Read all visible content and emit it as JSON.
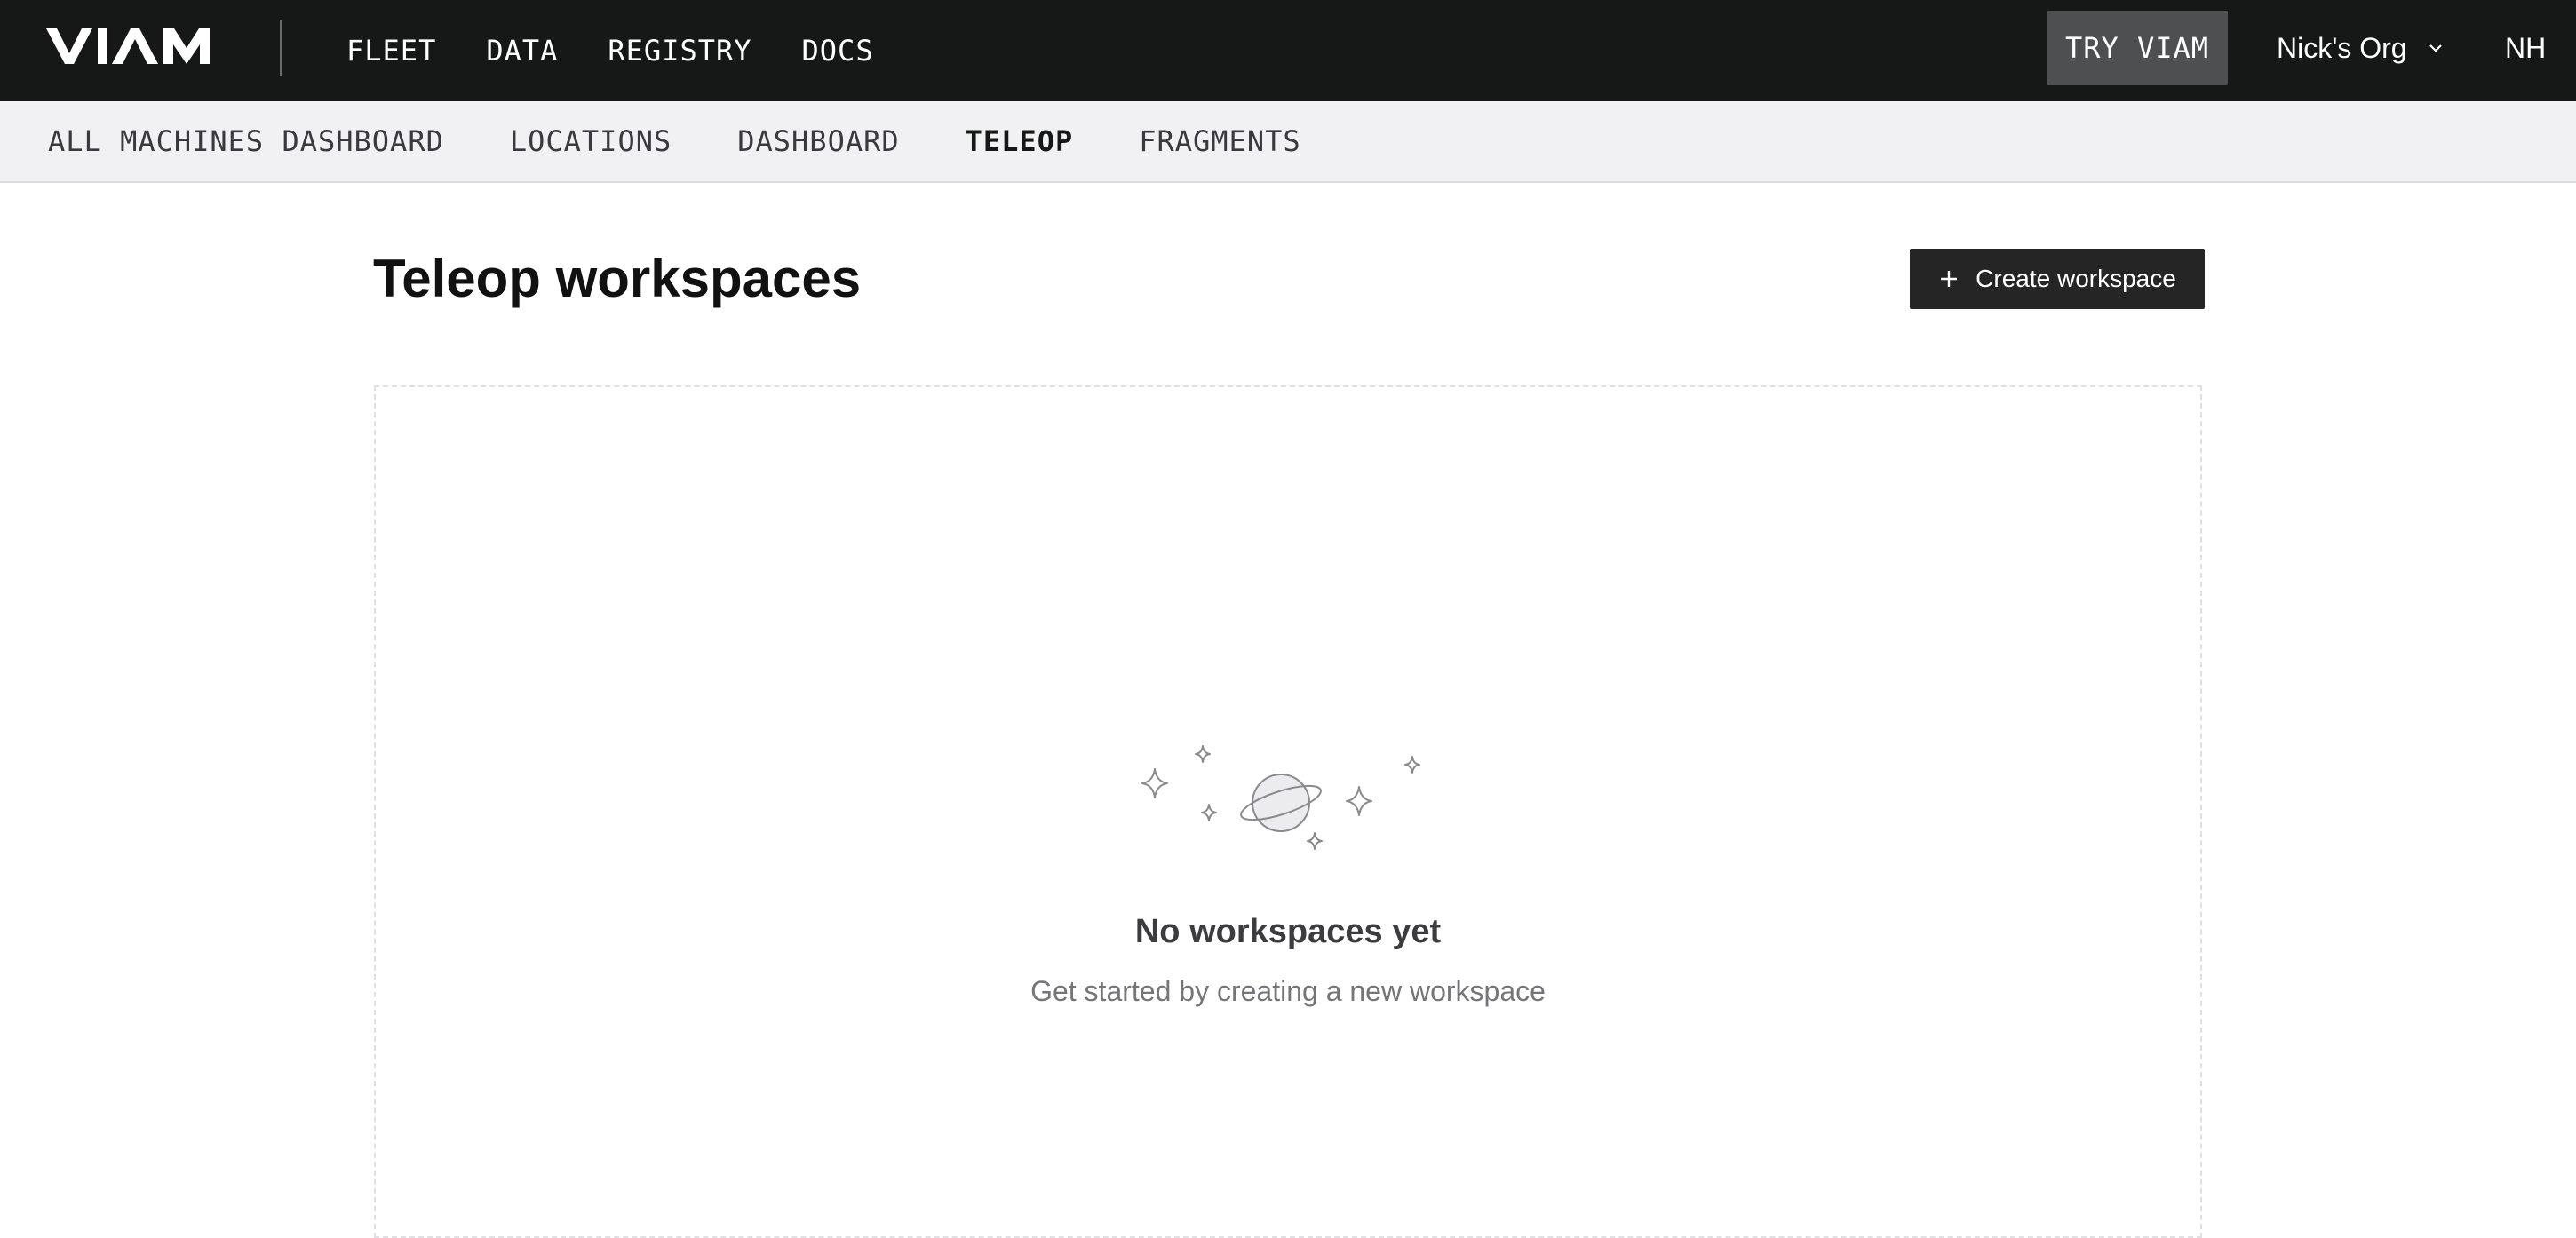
{
  "header": {
    "logo_text": "VIAM",
    "nav": [
      "FLEET",
      "DATA",
      "REGISTRY",
      "DOCS"
    ],
    "try_button": "TRY VIAM",
    "org_name": "Nick's Org",
    "avatar_initials": "NH"
  },
  "subnav": {
    "items": [
      "ALL MACHINES DASHBOARD",
      "LOCATIONS",
      "DASHBOARD",
      "TELEOP",
      "FRAGMENTS"
    ],
    "active": "TELEOP"
  },
  "main": {
    "title": "Teleop workspaces",
    "create_button": "Create workspace",
    "empty_state": {
      "title": "No workspaces yet",
      "subtitle": "Get started by creating a new workspace"
    }
  },
  "colors": {
    "header_bg": "#161717",
    "subnav_bg": "#f1f1f3",
    "button_bg": "#252525",
    "try_button_bg": "#4d4f50"
  },
  "icons": [
    "viam-logo",
    "chevron-down-icon",
    "plus-icon",
    "planet-icon",
    "sparkle-icon"
  ]
}
